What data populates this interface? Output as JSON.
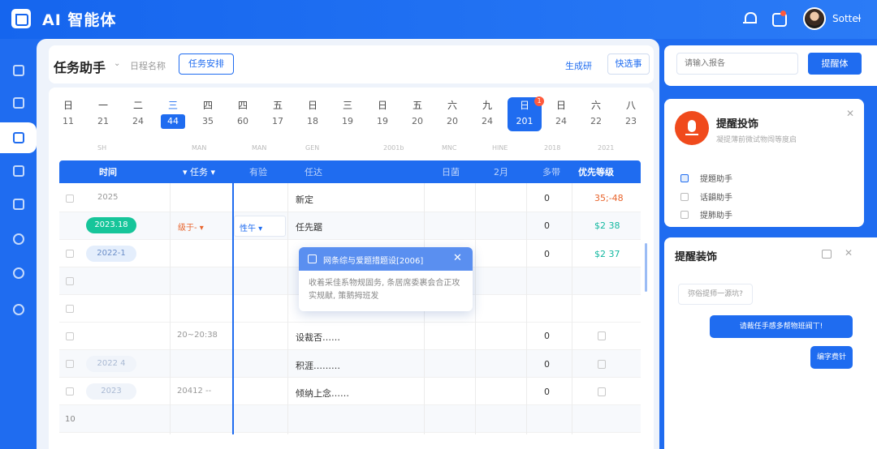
{
  "app": {
    "title": "AI 智能体",
    "username": "Sottel"
  },
  "sidebar": {
    "items": [
      "home",
      "home-2",
      "qr-code",
      "chart",
      "calendar",
      "bug",
      "shield-outline",
      "shield"
    ]
  },
  "header": {
    "title": "任务助手",
    "schedule_name": "日程名称",
    "task_button": "任务安排",
    "gen_link": "生成研",
    "quick_button": "快选事"
  },
  "calendar": {
    "days": [
      {
        "wk": "日",
        "dt": "11"
      },
      {
        "wk": "一",
        "dt": "21"
      },
      {
        "wk": "二",
        "dt": "24"
      },
      {
        "wk": "三",
        "dt": "44"
      },
      {
        "wk": "四",
        "dt": "35"
      },
      {
        "wk": "四",
        "dt": "60"
      },
      {
        "wk": "五",
        "dt": "17"
      },
      {
        "wk": "日",
        "dt": "18"
      },
      {
        "wk": "三",
        "dt": "19"
      },
      {
        "wk": "日",
        "dt": "19"
      },
      {
        "wk": "五",
        "dt": "20"
      },
      {
        "wk": "六",
        "dt": "20"
      },
      {
        "wk": "九",
        "dt": "24"
      },
      {
        "wk": "日",
        "dt": "201"
      },
      {
        "wk": "日",
        "dt": "24"
      },
      {
        "wk": "六",
        "dt": "22"
      },
      {
        "wk": "八",
        "dt": "23"
      }
    ],
    "badge": "1",
    "subheads": [
      "SH",
      "MAN",
      "MAN",
      "GEN",
      "2001b",
      "MNC",
      "HINE",
      "2018",
      "2021"
    ]
  },
  "table": {
    "headers": [
      "时间",
      "任务",
      "有验",
      "任达",
      "日菌",
      "2月",
      "多带",
      "优先等级"
    ],
    "rows": [
      {
        "time": "2025",
        "col4": "新定",
        "count": "0",
        "priority": "35;-48",
        "prio_color": "red"
      },
      {
        "time": "2023.18",
        "task": "级于-",
        "col3": "性午",
        "col4": "任先踞",
        "count": "0",
        "priority": "$2  38",
        "prio_color": "teal"
      },
      {
        "time": "2022-1",
        "count": "0",
        "priority": "$2  37",
        "prio_color": "teal"
      },
      {},
      {},
      {
        "task": "20~20:38",
        "col4": "设裁否……",
        "count": "0"
      },
      {
        "time": "2022 4",
        "col4": "积涯………",
        "count": "0"
      },
      {
        "time": "2023",
        "task": "20412 --",
        "col4": "倾纳上念……",
        "count": "0"
      },
      {
        "num": "10"
      }
    ]
  },
  "popup": {
    "title": "网条综与爱题措题设[2006]",
    "body": "收着采佳系物规固务, 条居席委裹会合正攻实规献, 策鹅拇班发"
  },
  "right": {
    "search_placeholder": "请输入报各",
    "remind_button": "提醒体",
    "card2": {
      "title": "提醒投饰",
      "sub": "凝提薄前微试物闯等度启",
      "options": [
        "提題助手",
        "话韻助手",
        "提肺助手"
      ]
    },
    "card3": {
      "title": "提醒装饰",
      "in_msg": "弥俗提师一源坑?",
      "out_msg1": "请裁任手感多帮物班阀丅!",
      "out_msg2": "编字费针"
    }
  }
}
